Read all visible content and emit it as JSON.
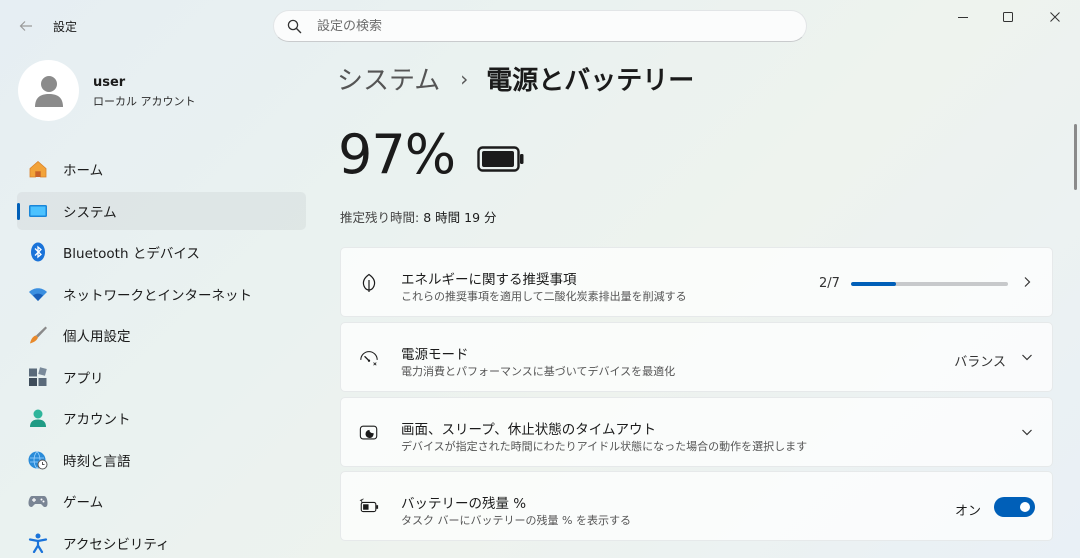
{
  "titlebar": {
    "app_title": "設定",
    "search_placeholder": "設定の検索"
  },
  "user": {
    "name": "user",
    "account_type": "ローカル アカウント"
  },
  "nav": {
    "items": [
      {
        "label": "ホーム",
        "icon": "home-icon"
      },
      {
        "label": "システム",
        "icon": "system-icon",
        "active": true
      },
      {
        "label": "Bluetooth とデバイス",
        "icon": "bluetooth-icon"
      },
      {
        "label": "ネットワークとインターネット",
        "icon": "network-icon"
      },
      {
        "label": "個人用設定",
        "icon": "brush-icon"
      },
      {
        "label": "アプリ",
        "icon": "apps-icon"
      },
      {
        "label": "アカウント",
        "icon": "account-icon"
      },
      {
        "label": "時刻と言語",
        "icon": "time-language-icon"
      },
      {
        "label": "ゲーム",
        "icon": "gamepad-icon"
      },
      {
        "label": "アクセシビリティ",
        "icon": "accessibility-icon"
      }
    ]
  },
  "main": {
    "breadcrumb_parent": "システム",
    "breadcrumb_separator": "›",
    "breadcrumb_current": "電源とバッテリー",
    "battery_percent": "97%",
    "battery_level": 0.97,
    "estimate_label": "推定残り時間:",
    "estimate_value": "8 時間 19 分",
    "cards": {
      "energy": {
        "title": "エネルギーに関する推奨事項",
        "subtitle": "これらの推奨事項を適用して二酸化炭素排出量を削減する",
        "progress_text": "2/7",
        "progress_done": 2,
        "progress_total": 7
      },
      "power_mode": {
        "title": "電源モード",
        "subtitle": "電力消費とパフォーマンスに基づいてデバイスを最適化",
        "value": "バランス"
      },
      "screen_sleep": {
        "title": "画面、スリープ、休止状態のタイムアウト",
        "subtitle": "デバイスが指定された時間にわたりアイドル状態になった場合の動作を選択します"
      },
      "battery_percent_toggle": {
        "title": "バッテリーの残量 %",
        "subtitle": "タスク バーにバッテリーの残量 % を表示する",
        "state_label": "オン",
        "on": true
      }
    }
  },
  "colors": {
    "accent": "#005fb8",
    "text": "#1b1b1b"
  }
}
